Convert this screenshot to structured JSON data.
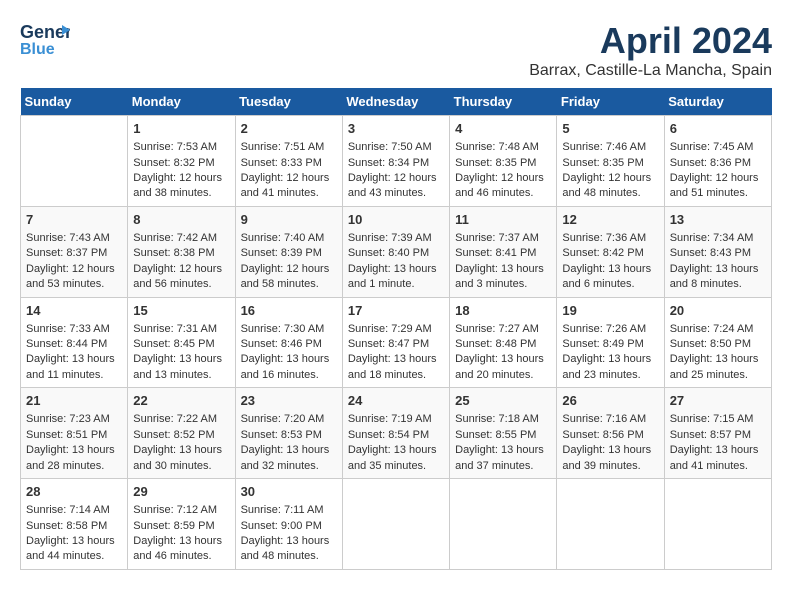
{
  "header": {
    "logo_general": "General",
    "logo_blue": "Blue",
    "month_year": "April 2024",
    "location": "Barrax, Castille-La Mancha, Spain"
  },
  "days_of_week": [
    "Sunday",
    "Monday",
    "Tuesday",
    "Wednesday",
    "Thursday",
    "Friday",
    "Saturday"
  ],
  "weeks": [
    [
      {
        "day": "",
        "sunrise": "",
        "sunset": "",
        "daylight": ""
      },
      {
        "day": "1",
        "sunrise": "Sunrise: 7:53 AM",
        "sunset": "Sunset: 8:32 PM",
        "daylight": "Daylight: 12 hours and 38 minutes."
      },
      {
        "day": "2",
        "sunrise": "Sunrise: 7:51 AM",
        "sunset": "Sunset: 8:33 PM",
        "daylight": "Daylight: 12 hours and 41 minutes."
      },
      {
        "day": "3",
        "sunrise": "Sunrise: 7:50 AM",
        "sunset": "Sunset: 8:34 PM",
        "daylight": "Daylight: 12 hours and 43 minutes."
      },
      {
        "day": "4",
        "sunrise": "Sunrise: 7:48 AM",
        "sunset": "Sunset: 8:35 PM",
        "daylight": "Daylight: 12 hours and 46 minutes."
      },
      {
        "day": "5",
        "sunrise": "Sunrise: 7:46 AM",
        "sunset": "Sunset: 8:35 PM",
        "daylight": "Daylight: 12 hours and 48 minutes."
      },
      {
        "day": "6",
        "sunrise": "Sunrise: 7:45 AM",
        "sunset": "Sunset: 8:36 PM",
        "daylight": "Daylight: 12 hours and 51 minutes."
      }
    ],
    [
      {
        "day": "7",
        "sunrise": "Sunrise: 7:43 AM",
        "sunset": "Sunset: 8:37 PM",
        "daylight": "Daylight: 12 hours and 53 minutes."
      },
      {
        "day": "8",
        "sunrise": "Sunrise: 7:42 AM",
        "sunset": "Sunset: 8:38 PM",
        "daylight": "Daylight: 12 hours and 56 minutes."
      },
      {
        "day": "9",
        "sunrise": "Sunrise: 7:40 AM",
        "sunset": "Sunset: 8:39 PM",
        "daylight": "Daylight: 12 hours and 58 minutes."
      },
      {
        "day": "10",
        "sunrise": "Sunrise: 7:39 AM",
        "sunset": "Sunset: 8:40 PM",
        "daylight": "Daylight: 13 hours and 1 minute."
      },
      {
        "day": "11",
        "sunrise": "Sunrise: 7:37 AM",
        "sunset": "Sunset: 8:41 PM",
        "daylight": "Daylight: 13 hours and 3 minutes."
      },
      {
        "day": "12",
        "sunrise": "Sunrise: 7:36 AM",
        "sunset": "Sunset: 8:42 PM",
        "daylight": "Daylight: 13 hours and 6 minutes."
      },
      {
        "day": "13",
        "sunrise": "Sunrise: 7:34 AM",
        "sunset": "Sunset: 8:43 PM",
        "daylight": "Daylight: 13 hours and 8 minutes."
      }
    ],
    [
      {
        "day": "14",
        "sunrise": "Sunrise: 7:33 AM",
        "sunset": "Sunset: 8:44 PM",
        "daylight": "Daylight: 13 hours and 11 minutes."
      },
      {
        "day": "15",
        "sunrise": "Sunrise: 7:31 AM",
        "sunset": "Sunset: 8:45 PM",
        "daylight": "Daylight: 13 hours and 13 minutes."
      },
      {
        "day": "16",
        "sunrise": "Sunrise: 7:30 AM",
        "sunset": "Sunset: 8:46 PM",
        "daylight": "Daylight: 13 hours and 16 minutes."
      },
      {
        "day": "17",
        "sunrise": "Sunrise: 7:29 AM",
        "sunset": "Sunset: 8:47 PM",
        "daylight": "Daylight: 13 hours and 18 minutes."
      },
      {
        "day": "18",
        "sunrise": "Sunrise: 7:27 AM",
        "sunset": "Sunset: 8:48 PM",
        "daylight": "Daylight: 13 hours and 20 minutes."
      },
      {
        "day": "19",
        "sunrise": "Sunrise: 7:26 AM",
        "sunset": "Sunset: 8:49 PM",
        "daylight": "Daylight: 13 hours and 23 minutes."
      },
      {
        "day": "20",
        "sunrise": "Sunrise: 7:24 AM",
        "sunset": "Sunset: 8:50 PM",
        "daylight": "Daylight: 13 hours and 25 minutes."
      }
    ],
    [
      {
        "day": "21",
        "sunrise": "Sunrise: 7:23 AM",
        "sunset": "Sunset: 8:51 PM",
        "daylight": "Daylight: 13 hours and 28 minutes."
      },
      {
        "day": "22",
        "sunrise": "Sunrise: 7:22 AM",
        "sunset": "Sunset: 8:52 PM",
        "daylight": "Daylight: 13 hours and 30 minutes."
      },
      {
        "day": "23",
        "sunrise": "Sunrise: 7:20 AM",
        "sunset": "Sunset: 8:53 PM",
        "daylight": "Daylight: 13 hours and 32 minutes."
      },
      {
        "day": "24",
        "sunrise": "Sunrise: 7:19 AM",
        "sunset": "Sunset: 8:54 PM",
        "daylight": "Daylight: 13 hours and 35 minutes."
      },
      {
        "day": "25",
        "sunrise": "Sunrise: 7:18 AM",
        "sunset": "Sunset: 8:55 PM",
        "daylight": "Daylight: 13 hours and 37 minutes."
      },
      {
        "day": "26",
        "sunrise": "Sunrise: 7:16 AM",
        "sunset": "Sunset: 8:56 PM",
        "daylight": "Daylight: 13 hours and 39 minutes."
      },
      {
        "day": "27",
        "sunrise": "Sunrise: 7:15 AM",
        "sunset": "Sunset: 8:57 PM",
        "daylight": "Daylight: 13 hours and 41 minutes."
      }
    ],
    [
      {
        "day": "28",
        "sunrise": "Sunrise: 7:14 AM",
        "sunset": "Sunset: 8:58 PM",
        "daylight": "Daylight: 13 hours and 44 minutes."
      },
      {
        "day": "29",
        "sunrise": "Sunrise: 7:12 AM",
        "sunset": "Sunset: 8:59 PM",
        "daylight": "Daylight: 13 hours and 46 minutes."
      },
      {
        "day": "30",
        "sunrise": "Sunrise: 7:11 AM",
        "sunset": "Sunset: 9:00 PM",
        "daylight": "Daylight: 13 hours and 48 minutes."
      },
      {
        "day": "",
        "sunrise": "",
        "sunset": "",
        "daylight": ""
      },
      {
        "day": "",
        "sunrise": "",
        "sunset": "",
        "daylight": ""
      },
      {
        "day": "",
        "sunrise": "",
        "sunset": "",
        "daylight": ""
      },
      {
        "day": "",
        "sunrise": "",
        "sunset": "",
        "daylight": ""
      }
    ]
  ]
}
